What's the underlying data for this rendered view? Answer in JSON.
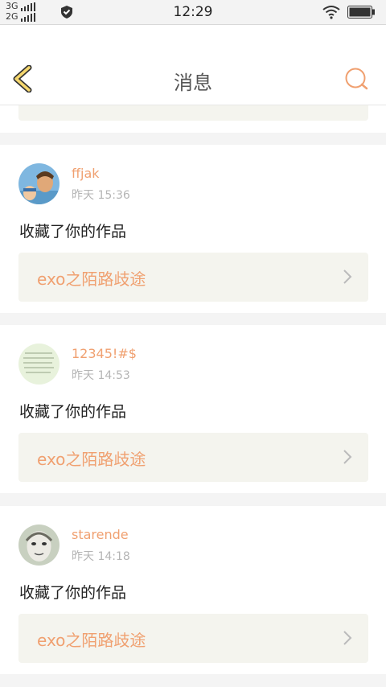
{
  "status": {
    "net1": "3G",
    "net2": "2G",
    "time": "12:29"
  },
  "header": {
    "title": "消息",
    "back_icon": "chevron-left-icon",
    "search_icon": "search-icon"
  },
  "notifications": [
    {
      "username": "ffjak",
      "time": "昨天 15:36",
      "message": "收藏了你的作品",
      "work_title": "exo之陌路歧途"
    },
    {
      "username": "12345!#$",
      "time": "昨天 14:53",
      "message": "收藏了你的作品",
      "work_title": "exo之陌路歧途"
    },
    {
      "username": "starende",
      "time": "昨天 14:18",
      "message": "收藏了你的作品",
      "work_title": "exo之陌路歧途"
    }
  ],
  "colors": {
    "accent": "#f0a070",
    "card_bg": "#ffffff",
    "page_bg": "#f4f4f4",
    "work_bg": "#f4f4ee"
  }
}
